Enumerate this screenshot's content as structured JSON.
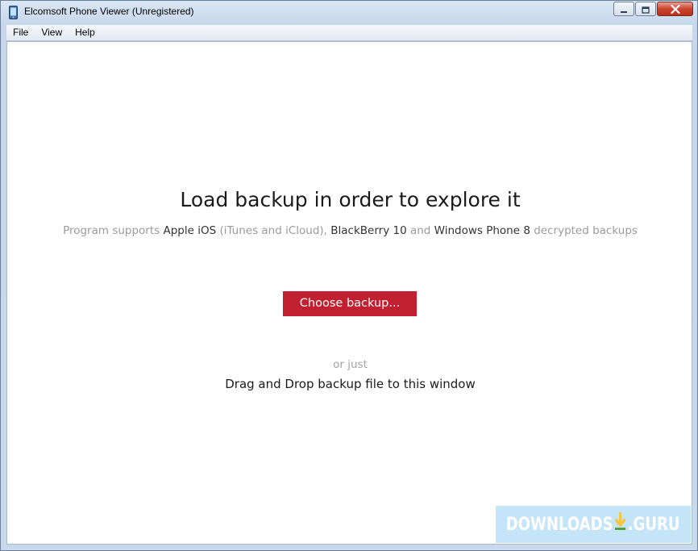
{
  "window": {
    "title": "Elcomsoft Phone Viewer (Unregistered)"
  },
  "menu": {
    "items": [
      {
        "label": "File"
      },
      {
        "label": "View"
      },
      {
        "label": "Help"
      }
    ]
  },
  "main": {
    "headline": "Load backup in order to explore it",
    "supports": {
      "prefix": "Program supports ",
      "apple": "Apple iOS",
      "apple_note": " (iTunes and iCloud), ",
      "blackberry": "BlackBerry 10",
      "and": " and ",
      "windows": "Windows Phone 8",
      "suffix": " decrypted backups"
    },
    "choose_button_label": "Choose backup...",
    "or_just": "or just",
    "drag_drop_text": "Drag and Drop backup file to this window"
  },
  "watermark": {
    "left_text": "DOWNLOADS",
    "right_text": ".GURU"
  },
  "colors": {
    "accent_button": "#c0202f",
    "watermark_bg": "#c4e5f7",
    "watermark_arrow": "#f4c542"
  },
  "icons": {
    "app": "phone-icon",
    "minimize": "minimize-icon",
    "maximize": "maximize-icon",
    "close": "close-icon",
    "watermark": "download-arrow-icon"
  }
}
